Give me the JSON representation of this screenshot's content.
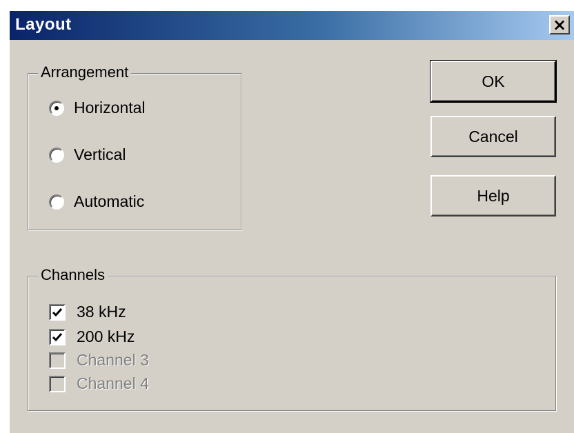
{
  "window": {
    "title": "Layout",
    "close_label": "×"
  },
  "arrangement": {
    "legend": "Arrangement",
    "options": [
      {
        "label": "Horizontal",
        "selected": true
      },
      {
        "label": "Vertical",
        "selected": false
      },
      {
        "label": "Automatic",
        "selected": false
      }
    ]
  },
  "channels": {
    "legend": "Channels",
    "items": [
      {
        "label": "38 kHz",
        "checked": true,
        "enabled": true
      },
      {
        "label": "200 kHz",
        "checked": true,
        "enabled": true
      },
      {
        "label": "Channel 3",
        "checked": false,
        "enabled": false
      },
      {
        "label": "Channel 4",
        "checked": false,
        "enabled": false
      }
    ]
  },
  "buttons": {
    "ok": "OK",
    "cancel": "Cancel",
    "help": "Help"
  }
}
